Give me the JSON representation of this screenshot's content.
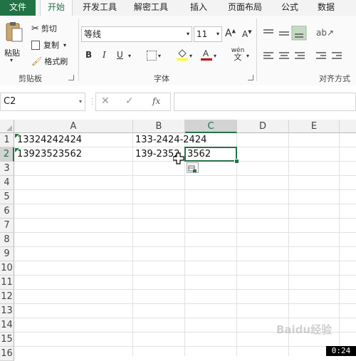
{
  "tabs": [
    "文件",
    "开始",
    "开发工具",
    "解密工具",
    "插入",
    "页面布局",
    "公式",
    "数据"
  ],
  "clipboard": {
    "paste": "粘贴",
    "cut": "剪切",
    "copy": "复制",
    "format_painter": "格式刷",
    "group": "剪贴板"
  },
  "font": {
    "name": "等线",
    "size": "11",
    "group": "字体",
    "bold": "B",
    "italic": "I",
    "underline": "U",
    "grow": "A",
    "shrink": "A",
    "wen": "wén",
    "wen_char": "文"
  },
  "alignment": {
    "group": "对齐方式"
  },
  "formula_bar": {
    "name_box": "C2",
    "cancel": "✕",
    "enter": "✓",
    "fx": "fx",
    "value": ""
  },
  "columns": [
    "A",
    "B",
    "C",
    "D",
    "E"
  ],
  "rows": [
    "1",
    "2",
    "3",
    "4",
    "5",
    "6",
    "7",
    "8",
    "9",
    "10",
    "11",
    "12",
    "13",
    "14",
    "15",
    "16"
  ],
  "cells": {
    "A1": "13324242424",
    "B1": "133-2424-2424",
    "A2": "13923523562",
    "B2": "139-2352",
    "C2": "3562"
  },
  "selected_cell": "C2",
  "video_time": "0:24",
  "watermark": "Baidu经验",
  "colors": {
    "accent": "#217346",
    "file_tab": "#217346"
  }
}
